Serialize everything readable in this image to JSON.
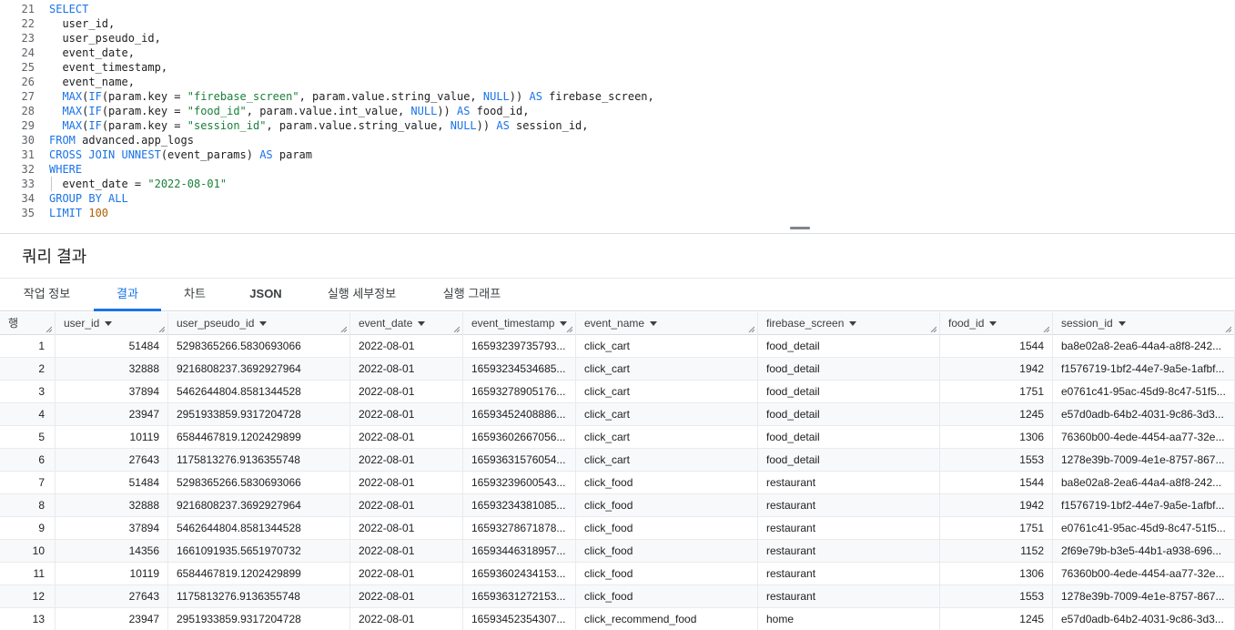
{
  "editor": {
    "lines": [
      {
        "n": "21",
        "parts": [
          [
            "kw",
            "SELECT"
          ]
        ]
      },
      {
        "n": "22",
        "parts": [
          [
            "t",
            "  user_id,"
          ]
        ]
      },
      {
        "n": "23",
        "parts": [
          [
            "t",
            "  user_pseudo_id,"
          ]
        ]
      },
      {
        "n": "24",
        "parts": [
          [
            "t",
            "  event_date,"
          ]
        ]
      },
      {
        "n": "25",
        "parts": [
          [
            "t",
            "  event_timestamp,"
          ]
        ]
      },
      {
        "n": "26",
        "parts": [
          [
            "t",
            "  event_name,"
          ]
        ]
      },
      {
        "n": "27",
        "parts": [
          [
            "t",
            "  "
          ],
          [
            "kw",
            "MAX"
          ],
          [
            "t",
            "("
          ],
          [
            "kw",
            "IF"
          ],
          [
            "t",
            "(param.key = "
          ],
          [
            "str",
            "\"firebase_screen\""
          ],
          [
            "t",
            ", param.value.string_value, "
          ],
          [
            "kw",
            "NULL"
          ],
          [
            "t",
            ")) "
          ],
          [
            "kw",
            "AS"
          ],
          [
            "t",
            " firebase_screen,"
          ]
        ]
      },
      {
        "n": "28",
        "parts": [
          [
            "t",
            "  "
          ],
          [
            "kw",
            "MAX"
          ],
          [
            "t",
            "("
          ],
          [
            "kw",
            "IF"
          ],
          [
            "t",
            "(param.key = "
          ],
          [
            "str",
            "\"food_id\""
          ],
          [
            "t",
            ", param.value.int_value, "
          ],
          [
            "kw",
            "NULL"
          ],
          [
            "t",
            ")) "
          ],
          [
            "kw",
            "AS"
          ],
          [
            "t",
            " food_id,"
          ]
        ]
      },
      {
        "n": "29",
        "parts": [
          [
            "t",
            "  "
          ],
          [
            "kw",
            "MAX"
          ],
          [
            "t",
            "("
          ],
          [
            "kw",
            "IF"
          ],
          [
            "t",
            "(param.key = "
          ],
          [
            "str",
            "\"session_id\""
          ],
          [
            "t",
            ", param.value.string_value, "
          ],
          [
            "kw",
            "NULL"
          ],
          [
            "t",
            ")) "
          ],
          [
            "kw",
            "AS"
          ],
          [
            "t",
            " session_id,"
          ]
        ]
      },
      {
        "n": "30",
        "parts": [
          [
            "kw",
            "FROM"
          ],
          [
            "t",
            " advanced.app_logs"
          ]
        ]
      },
      {
        "n": "31",
        "parts": [
          [
            "kw",
            "CROSS JOIN UNNEST"
          ],
          [
            "t",
            "(event_params) "
          ],
          [
            "kw",
            "AS"
          ],
          [
            "t",
            " param"
          ]
        ]
      },
      {
        "n": "32",
        "parts": [
          [
            "kw",
            "WHERE"
          ]
        ]
      },
      {
        "n": "33",
        "parts": [
          [
            "t",
            "  event_date = "
          ],
          [
            "str",
            "\"2022-08-01\""
          ]
        ]
      },
      {
        "n": "34",
        "parts": [
          [
            "kw",
            "GROUP BY ALL"
          ]
        ]
      },
      {
        "n": "35",
        "parts": [
          [
            "kw",
            "LIMIT"
          ],
          [
            "t",
            " "
          ],
          [
            "num",
            "100"
          ]
        ]
      }
    ]
  },
  "results": {
    "title": "쿼리 결과",
    "tabs": [
      "작업 정보",
      "결과",
      "차트",
      "JSON",
      "실행 세부정보",
      "실행 그래프"
    ],
    "active_tab": 1,
    "columns": [
      "행",
      "user_id",
      "user_pseudo_id",
      "event_date",
      "event_timestamp",
      "event_name",
      "firebase_screen",
      "food_id",
      "session_id"
    ],
    "rows": [
      [
        "1",
        "51484",
        "5298365266.5830693066",
        "2022-08-01",
        "16593239735793...",
        "click_cart",
        "food_detail",
        "1544",
        "ba8e02a8-2ea6-44a4-a8f8-242..."
      ],
      [
        "2",
        "32888",
        "9216808237.3692927964",
        "2022-08-01",
        "16593234534685...",
        "click_cart",
        "food_detail",
        "1942",
        "f1576719-1bf2-44e7-9a5e-1afbf..."
      ],
      [
        "3",
        "37894",
        "5462644804.8581344528",
        "2022-08-01",
        "16593278905176...",
        "click_cart",
        "food_detail",
        "1751",
        "e0761c41-95ac-45d9-8c47-51f5..."
      ],
      [
        "4",
        "23947",
        "2951933859.9317204728",
        "2022-08-01",
        "16593452408886...",
        "click_cart",
        "food_detail",
        "1245",
        "e57d0adb-64b2-4031-9c86-3d3..."
      ],
      [
        "5",
        "10119",
        "6584467819.1202429899",
        "2022-08-01",
        "16593602667056...",
        "click_cart",
        "food_detail",
        "1306",
        "76360b00-4ede-4454-aa77-32e..."
      ],
      [
        "6",
        "27643",
        "1175813276.9136355748",
        "2022-08-01",
        "16593631576054...",
        "click_cart",
        "food_detail",
        "1553",
        "1278e39b-7009-4e1e-8757-867..."
      ],
      [
        "7",
        "51484",
        "5298365266.5830693066",
        "2022-08-01",
        "16593239600543...",
        "click_food",
        "restaurant",
        "1544",
        "ba8e02a8-2ea6-44a4-a8f8-242..."
      ],
      [
        "8",
        "32888",
        "9216808237.3692927964",
        "2022-08-01",
        "16593234381085...",
        "click_food",
        "restaurant",
        "1942",
        "f1576719-1bf2-44e7-9a5e-1afbf..."
      ],
      [
        "9",
        "37894",
        "5462644804.8581344528",
        "2022-08-01",
        "16593278671878...",
        "click_food",
        "restaurant",
        "1751",
        "e0761c41-95ac-45d9-8c47-51f5..."
      ],
      [
        "10",
        "14356",
        "1661091935.5651970732",
        "2022-08-01",
        "16593446318957...",
        "click_food",
        "restaurant",
        "1152",
        "2f69e79b-b3e5-44b1-a938-696..."
      ],
      [
        "11",
        "10119",
        "6584467819.1202429899",
        "2022-08-01",
        "16593602434153...",
        "click_food",
        "restaurant",
        "1306",
        "76360b00-4ede-4454-aa77-32e..."
      ],
      [
        "12",
        "27643",
        "1175813276.9136355748",
        "2022-08-01",
        "16593631272153...",
        "click_food",
        "restaurant",
        "1553",
        "1278e39b-7009-4e1e-8757-867..."
      ],
      [
        "13",
        "23947",
        "2951933859.9317204728",
        "2022-08-01",
        "16593452354307...",
        "click_recommend_food",
        "home",
        "1245",
        "e57d0adb-64b2-4031-9c86-3d3..."
      ]
    ]
  }
}
